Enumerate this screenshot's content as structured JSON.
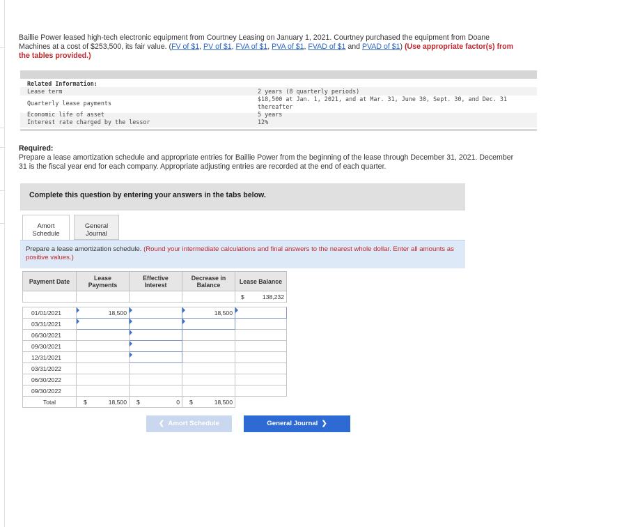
{
  "intro": {
    "text_before": "Baillie Power leased high-tech electronic equipment from Courtney Leasing on January 1, 2021. Courtney purchased the equipment from Doane Machines at a cost of $253,500, its fair value. (",
    "links": [
      "FV of $1",
      "PV of $1",
      "FVA of $1",
      "PVA of $1",
      "FVAD of $1",
      "PVAD of $1"
    ],
    "sep": ", ",
    "and": " and ",
    "close": ") ",
    "red_note": "(Use appropriate factor(s) from the tables provided.)"
  },
  "related": {
    "title": "Related Information:",
    "rows": [
      {
        "label": "Lease term",
        "value": "2 years (8 quarterly periods)"
      },
      {
        "label": "Quarterly lease payments",
        "value": "$18,500 at Jan. 1, 2021, and at Mar. 31, June 30, Sept. 30, and Dec. 31 thereafter"
      },
      {
        "label": "Economic life of asset",
        "value": "5 years"
      },
      {
        "label": "Interest rate charged by the lessor",
        "value": "12%"
      }
    ]
  },
  "required": {
    "heading": "Required:",
    "text": "Prepare a lease amortization schedule and appropriate entries for Baillie Power from the beginning of the lease through December 31, 2021. December 31 is the fiscal year end for each company. Appropriate adjusting entries are recorded at the end of each quarter."
  },
  "complete_note": "Complete this question by entering your answers in the tabs below.",
  "tabs": {
    "amort": [
      "Amort",
      "Schedule"
    ],
    "journal": [
      "General",
      "Journal"
    ]
  },
  "instructions": {
    "main": "Prepare a lease amortization schedule. ",
    "red": "(Round your intermediate calculations and final answers to the nearest whole dollar. Enter all amounts as positive values.)"
  },
  "table": {
    "headers": {
      "date": "Payment Date",
      "payments": [
        "Lease",
        "Payments"
      ],
      "interest": [
        "Effective",
        "Interest"
      ],
      "decrease": [
        "Decrease in",
        "Balance"
      ],
      "balance": "Lease Balance"
    },
    "currency": "$",
    "opening_balance": "138,232",
    "rows": [
      {
        "date": "01/01/2021",
        "payment": "18,500",
        "interest": "",
        "decrease": "18,500",
        "balance": ""
      },
      {
        "date": "03/31/2021",
        "payment": "",
        "interest": "",
        "decrease": "",
        "balance": ""
      },
      {
        "date": "06/30/2021",
        "payment": "",
        "interest": "",
        "decrease": "",
        "balance": ""
      },
      {
        "date": "09/30/2021",
        "payment": "",
        "interest": "",
        "decrease": "",
        "balance": ""
      },
      {
        "date": "12/31/2021",
        "payment": "",
        "interest": "",
        "decrease": "",
        "balance": ""
      },
      {
        "date": "03/31/2022",
        "payment": "",
        "interest": "",
        "decrease": "",
        "balance": ""
      },
      {
        "date": "06/30/2022",
        "payment": "",
        "interest": "",
        "decrease": "",
        "balance": ""
      },
      {
        "date": "09/30/2022",
        "payment": "",
        "interest": "",
        "decrease": "",
        "balance": ""
      }
    ],
    "total": {
      "label": "Total",
      "payment": "18,500",
      "interest": "0",
      "decrease": "18,500"
    }
  },
  "nav": {
    "prev": "Amort Schedule",
    "next": "General Journal"
  }
}
